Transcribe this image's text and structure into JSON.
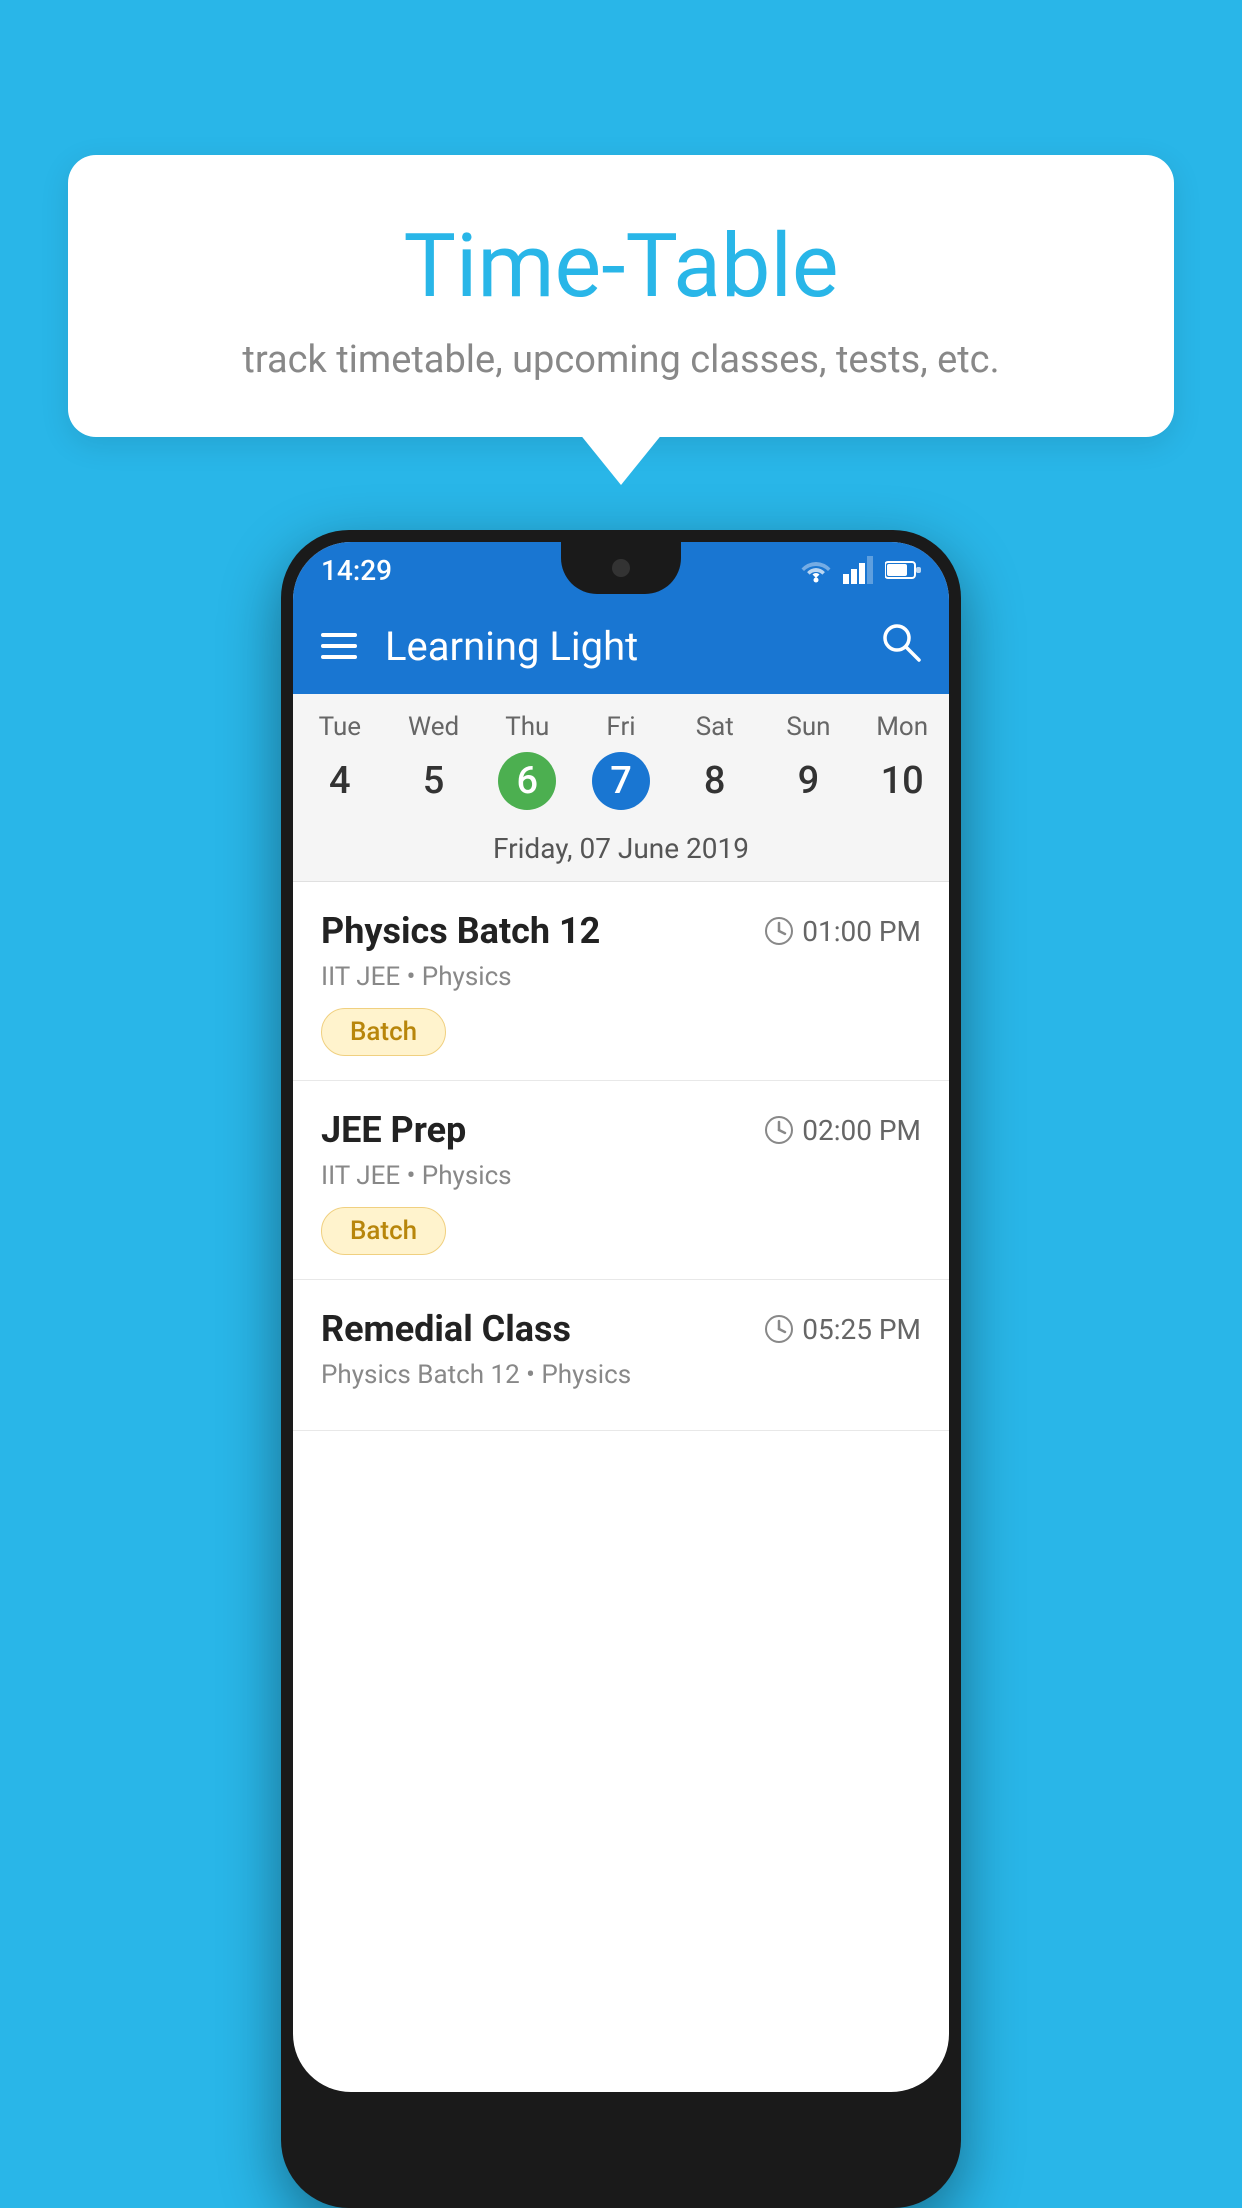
{
  "background_color": "#29b6e8",
  "speech_bubble": {
    "title": "Time-Table",
    "subtitle": "track timetable, upcoming classes, tests, etc."
  },
  "phone": {
    "status_bar": {
      "time": "14:29",
      "wifi": "▾",
      "signal": "▾",
      "battery": "▌"
    },
    "app_bar": {
      "title": "Learning Light",
      "menu_icon": "menu",
      "search_icon": "search"
    },
    "calendar": {
      "days": [
        {
          "name": "Tue",
          "number": "4",
          "state": "normal"
        },
        {
          "name": "Wed",
          "number": "5",
          "state": "normal"
        },
        {
          "name": "Thu",
          "number": "6",
          "state": "today"
        },
        {
          "name": "Fri",
          "number": "7",
          "state": "selected"
        },
        {
          "name": "Sat",
          "number": "8",
          "state": "normal"
        },
        {
          "name": "Sun",
          "number": "9",
          "state": "normal"
        },
        {
          "name": "Mon",
          "number": "10",
          "state": "normal"
        }
      ],
      "selected_date_label": "Friday, 07 June 2019"
    },
    "schedule": [
      {
        "title": "Physics Batch 12",
        "time": "01:00 PM",
        "meta": "IIT JEE • Physics",
        "badge": "Batch"
      },
      {
        "title": "JEE Prep",
        "time": "02:00 PM",
        "meta": "IIT JEE • Physics",
        "badge": "Batch"
      },
      {
        "title": "Remedial Class",
        "time": "05:25 PM",
        "meta": "Physics Batch 12 • Physics",
        "badge": ""
      }
    ]
  }
}
